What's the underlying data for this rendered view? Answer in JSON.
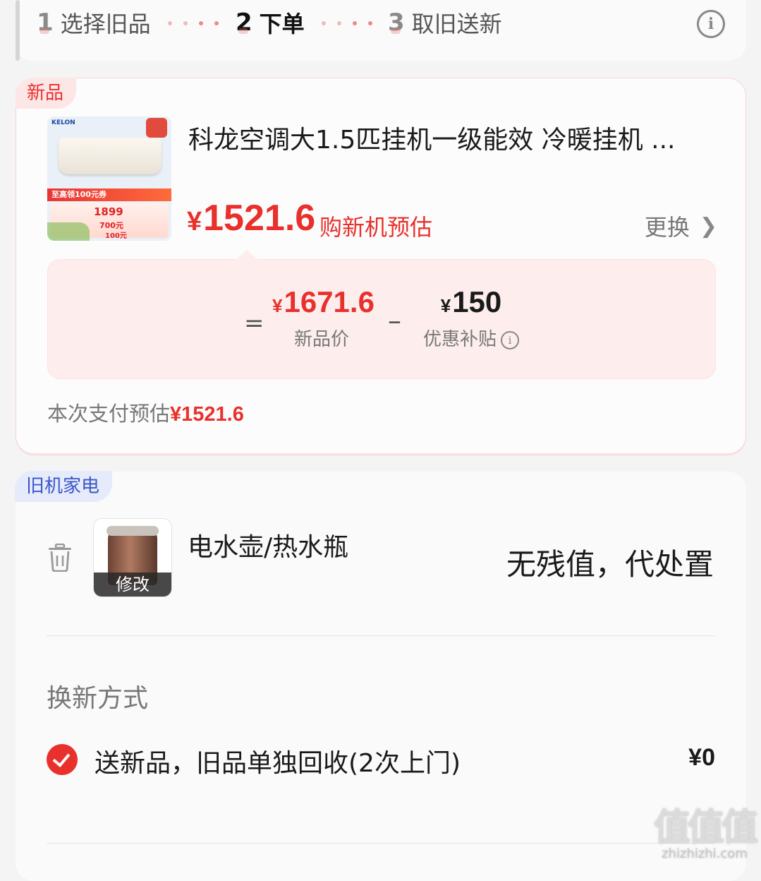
{
  "steps": [
    {
      "num": "1",
      "label": "选择旧品"
    },
    {
      "num": "2",
      "label": "下单"
    },
    {
      "num": "3",
      "label": "取旧送新"
    }
  ],
  "new_item": {
    "tag": "新品",
    "title": "科龙空调大1.5匹挂机一级能效 冷暖挂机 ...",
    "image": {
      "brand": "KELON",
      "strip_text": "至高领100元券",
      "promo_price": "1899",
      "promo_700": "700元",
      "promo_100": "100元"
    },
    "price_yen": "¥",
    "price": "1521.6",
    "price_note": "购新机预估",
    "change_label": "更换",
    "calc": {
      "eq": "=",
      "new_price_yen": "¥",
      "new_price": "1671.6",
      "new_price_label": "新品价",
      "minus": "–",
      "subsidy_yen": "¥",
      "subsidy": "150",
      "subsidy_label": "优惠补贴"
    },
    "pay_est_label": "本次支付预估",
    "pay_est_amount": "¥1521.6"
  },
  "old_item": {
    "tag": "旧机家电",
    "name": "电水壶/热水瓶",
    "edit_label": "修改",
    "value_text": "无残值，代处置",
    "method_title": "换新方式",
    "option_label": "送新品，旧品单独回收(2次上门)",
    "option_price": "¥0"
  },
  "watermark": {
    "logo": "值值值",
    "text": "zhizhizhi.com"
  },
  "colors": {
    "accent": "#e8302c",
    "old_tag_bg": "#e6ebfb",
    "old_tag_text": "#3a56c8"
  }
}
